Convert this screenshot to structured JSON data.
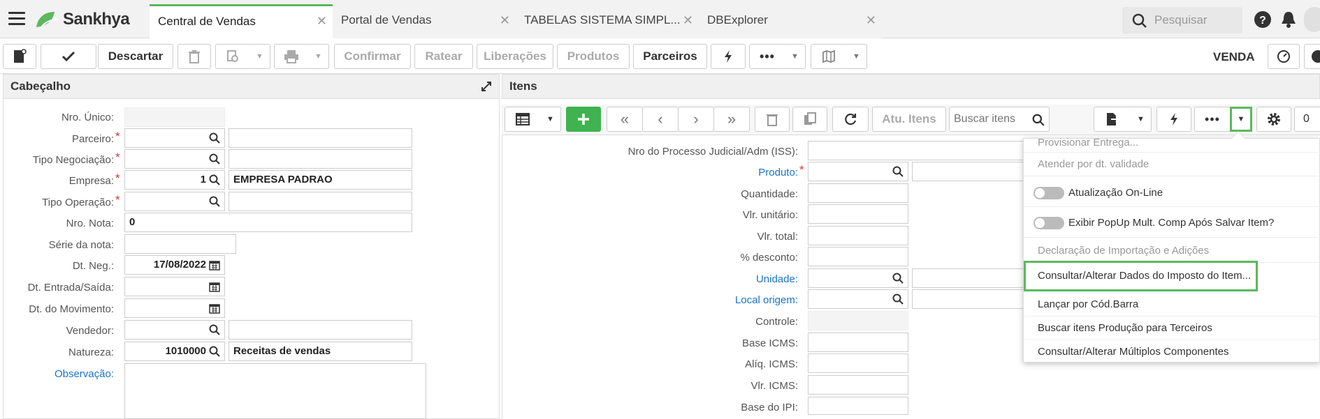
{
  "app": {
    "brand": "Sankhya"
  },
  "tabs": [
    {
      "label": "Central de Vendas"
    },
    {
      "label": "Portal de Vendas"
    },
    {
      "label": "TABELAS SISTEMA SIMPL..."
    },
    {
      "label": "DBExplorer"
    }
  ],
  "search": {
    "placeholder": "Pesquisar"
  },
  "toolbar": {
    "discard": "Descartar",
    "confirm": "Confirmar",
    "rate": "Ratear",
    "releases": "Liberações",
    "products": "Produtos",
    "partners": "Parceiros",
    "mode": "VENDA"
  },
  "header_panel": {
    "title": "Cabeçalho",
    "fields": {
      "nro_unico": {
        "label": "Nro. Único:"
      },
      "parceiro": {
        "label": "Parceiro:"
      },
      "tipo_negociacao": {
        "label": "Tipo Negociação:"
      },
      "empresa": {
        "label": "Empresa:",
        "value": "1",
        "description": "EMPRESA PADRAO"
      },
      "tipo_operacao": {
        "label": "Tipo Operação:"
      },
      "nro_nota": {
        "label": "Nro. Nota:",
        "value": "0"
      },
      "serie": {
        "label": "Série da nota:"
      },
      "dt_neg": {
        "label": "Dt. Neg.:",
        "value": "17/08/2022"
      },
      "dt_entrada": {
        "label": "Dt. Entrada/Saída:"
      },
      "dt_movimento": {
        "label": "Dt. do Movimento:"
      },
      "vendedor": {
        "label": "Vendedor:"
      },
      "natureza": {
        "label": "Natureza:",
        "value": "1010000",
        "description": "Receitas de vendas"
      },
      "observacao": {
        "label": "Observação:"
      }
    }
  },
  "items_panel": {
    "title": "Itens",
    "update_items": "Atu. Itens",
    "search_placeholder": "Buscar itens",
    "count": "0",
    "fields": {
      "processo": "Nro do Processo Judicial/Adm (ISS):",
      "produto": "Produto:",
      "quantidade": "Quantidade:",
      "vlr_unitario": "Vlr. unitário:",
      "vlr_total": "Vlr. total:",
      "desconto": "% desconto:",
      "unidade": "Unidade:",
      "local_origem": "Local origem:",
      "controle": "Controle:",
      "base_icms": "Base ICMS:",
      "aliq_icms": "Alíq. ICMS:",
      "vlr_icms": "Vlr. ICMS:",
      "base_ipi": "Base do IPI:"
    }
  },
  "menu": {
    "items": [
      {
        "label": "Provisionar Entrega..."
      },
      {
        "label": "Atender por dt. validade"
      },
      {
        "label": "Atualização On-Line"
      },
      {
        "label": "Exibir PopUp Mult. Comp Após Salvar Item?"
      },
      {
        "label": "Declaração de Importação e Adições"
      },
      {
        "label": "Consultar/Alterar Dados do Imposto do Item..."
      },
      {
        "label": "Lançar por Cód.Barra"
      },
      {
        "label": "Buscar itens Produção para Terceiros"
      },
      {
        "label": "Consultar/Alterar Múltiplos Componentes"
      }
    ]
  },
  "colors": {
    "accent": "#5cb85c",
    "link": "#1a73c9",
    "required": "#d33333"
  }
}
